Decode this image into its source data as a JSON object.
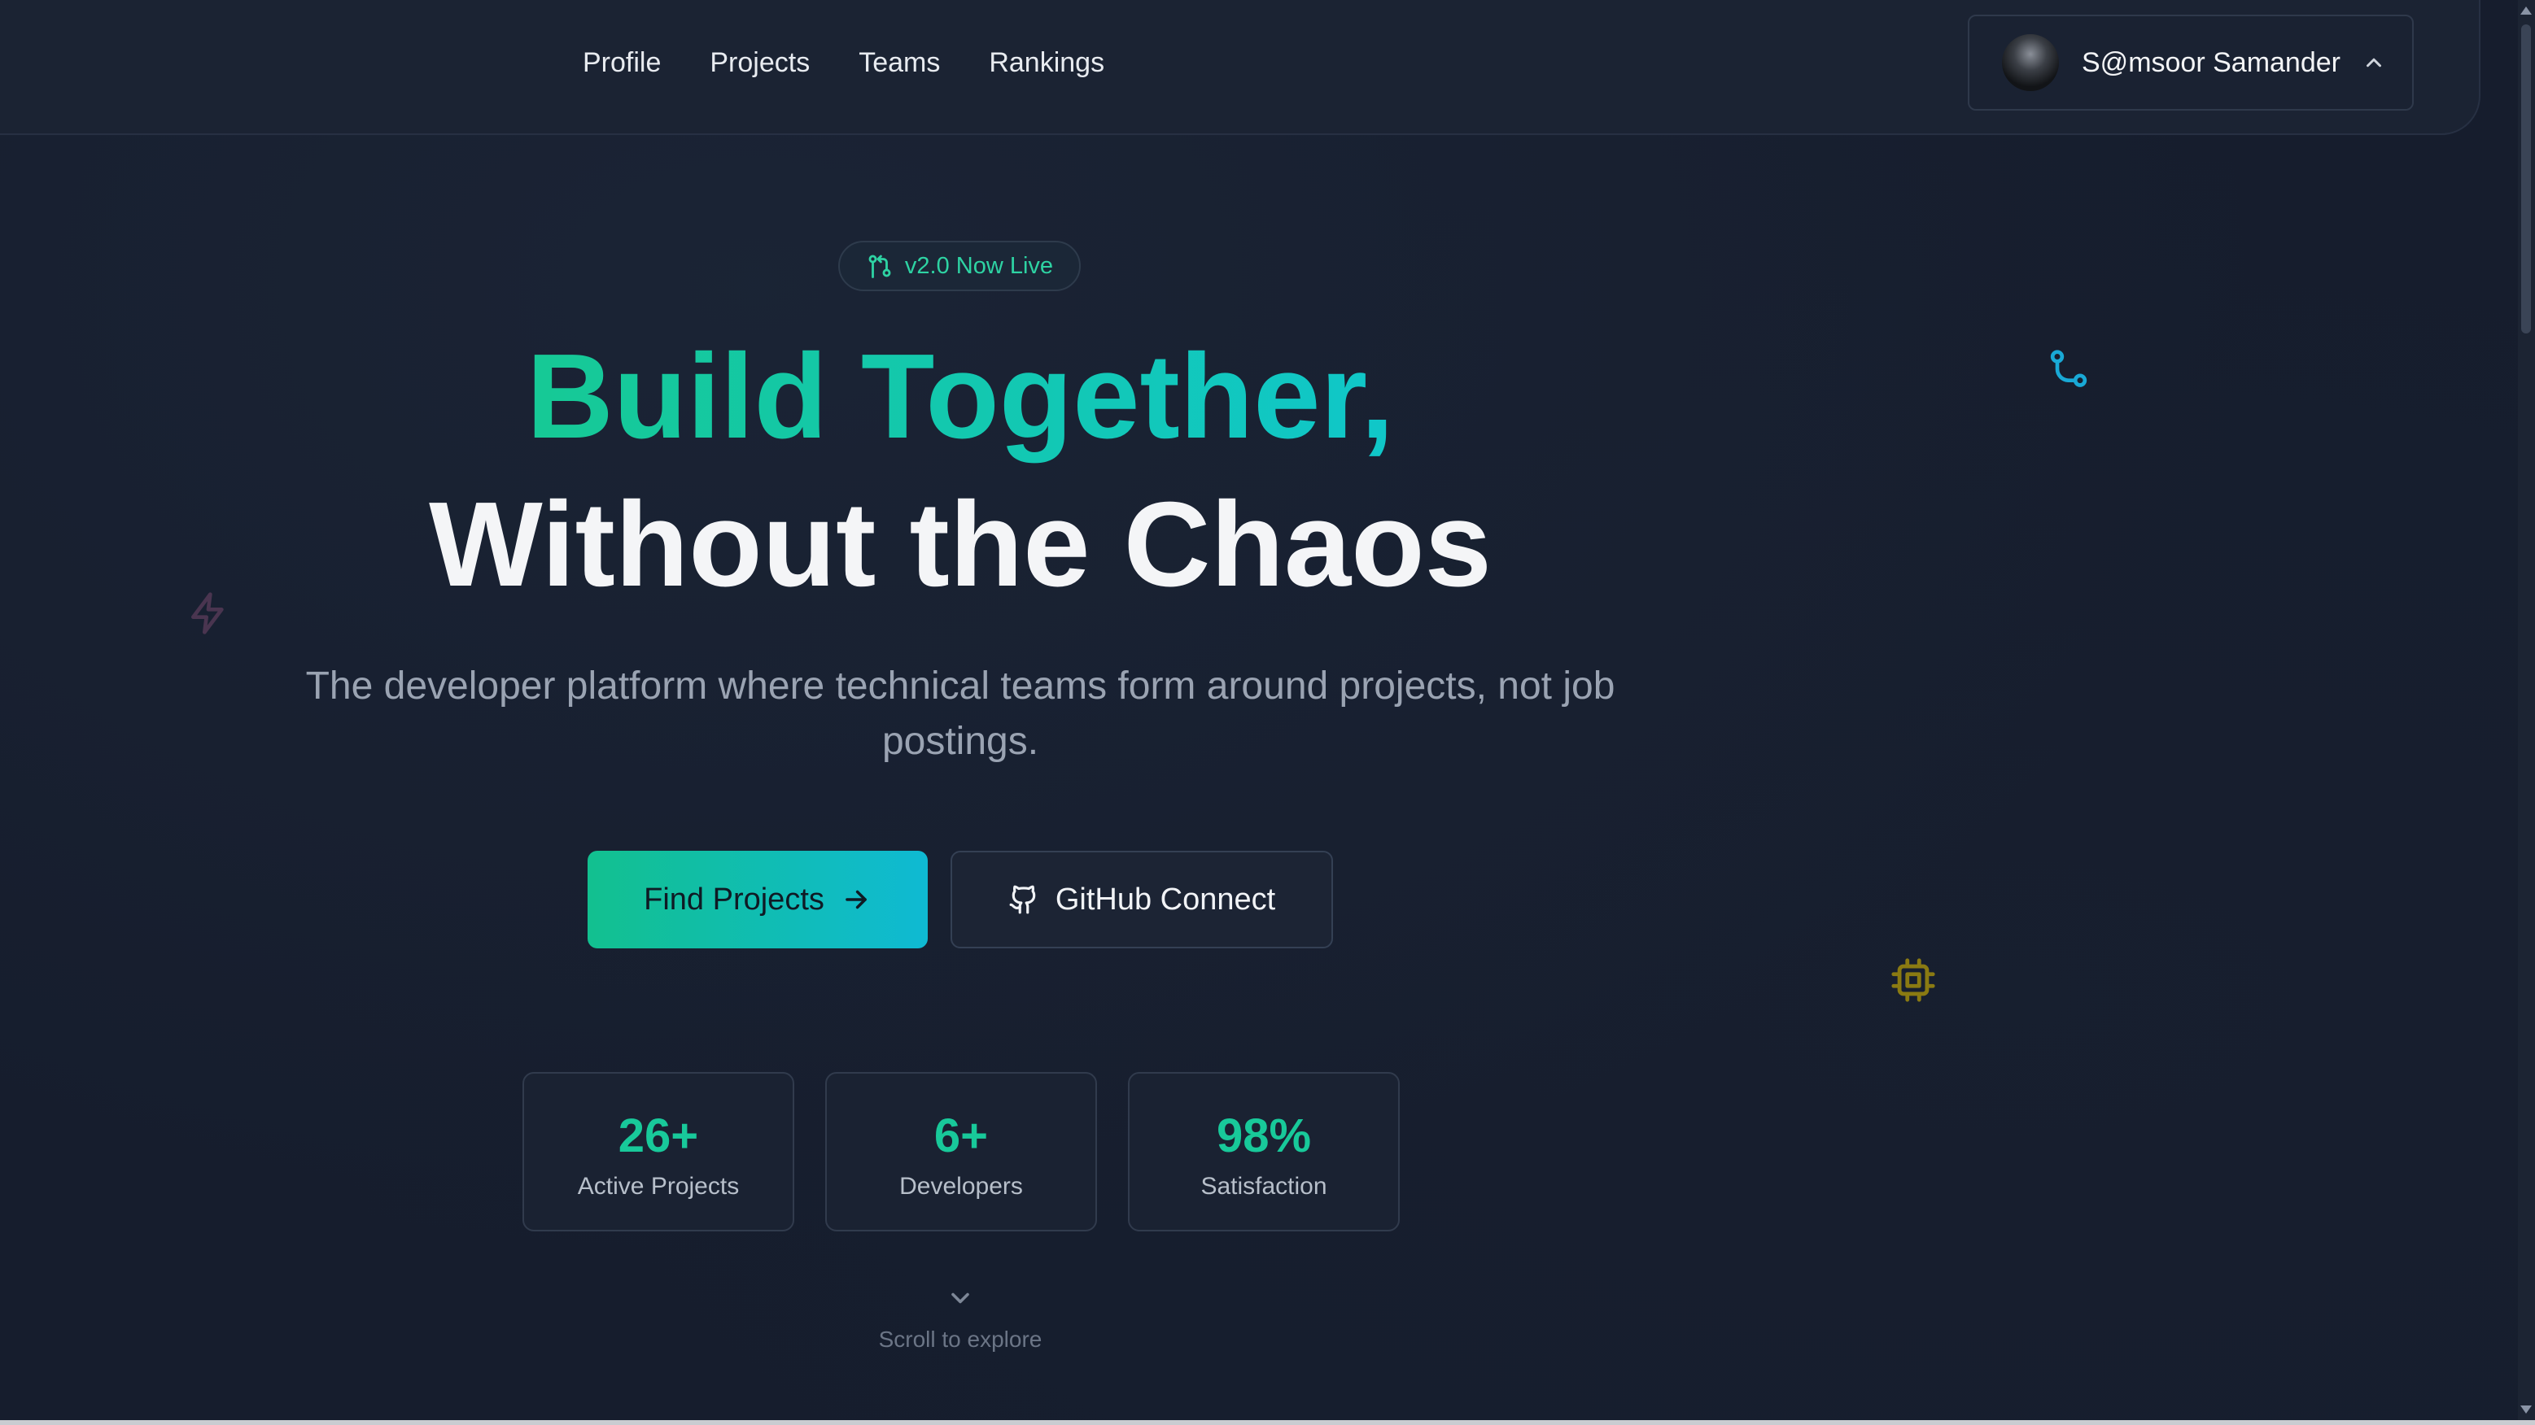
{
  "nav": {
    "links": [
      "Profile",
      "Projects",
      "Teams",
      "Rankings"
    ],
    "user": {
      "name": "S@msoor Samander"
    }
  },
  "hero": {
    "badge": "v2.0 Now Live",
    "title_line1": "Build Together,",
    "title_line2": "Without the Chaos",
    "subtitle": "The developer platform where technical teams form around projects, not job postings.",
    "primary_button": "Find Projects",
    "secondary_button": "GitHub Connect"
  },
  "stats": [
    {
      "value": "26+",
      "label": "Active Projects"
    },
    {
      "value": "6+",
      "label": "Developers"
    },
    {
      "value": "98%",
      "label": "Satisfaction"
    }
  ],
  "scroll_hint": "Scroll to explore",
  "colors": {
    "accent_green": "#16c995",
    "accent_cyan": "#0fbad3",
    "background": "#161d2d",
    "icon_yellow": "#8a7a12",
    "icon_blue": "#19a9d6",
    "icon_purple": "#4a3550"
  },
  "icons": {
    "badge": "git-pull-request-icon",
    "primary_button": "arrow-right-icon",
    "secondary_button": "github-icon",
    "user_menu": "chevron-up-icon",
    "scroll": "chevron-down-icon",
    "decorative": [
      "git-branch-icon",
      "zap-icon",
      "cpu-icon"
    ]
  }
}
